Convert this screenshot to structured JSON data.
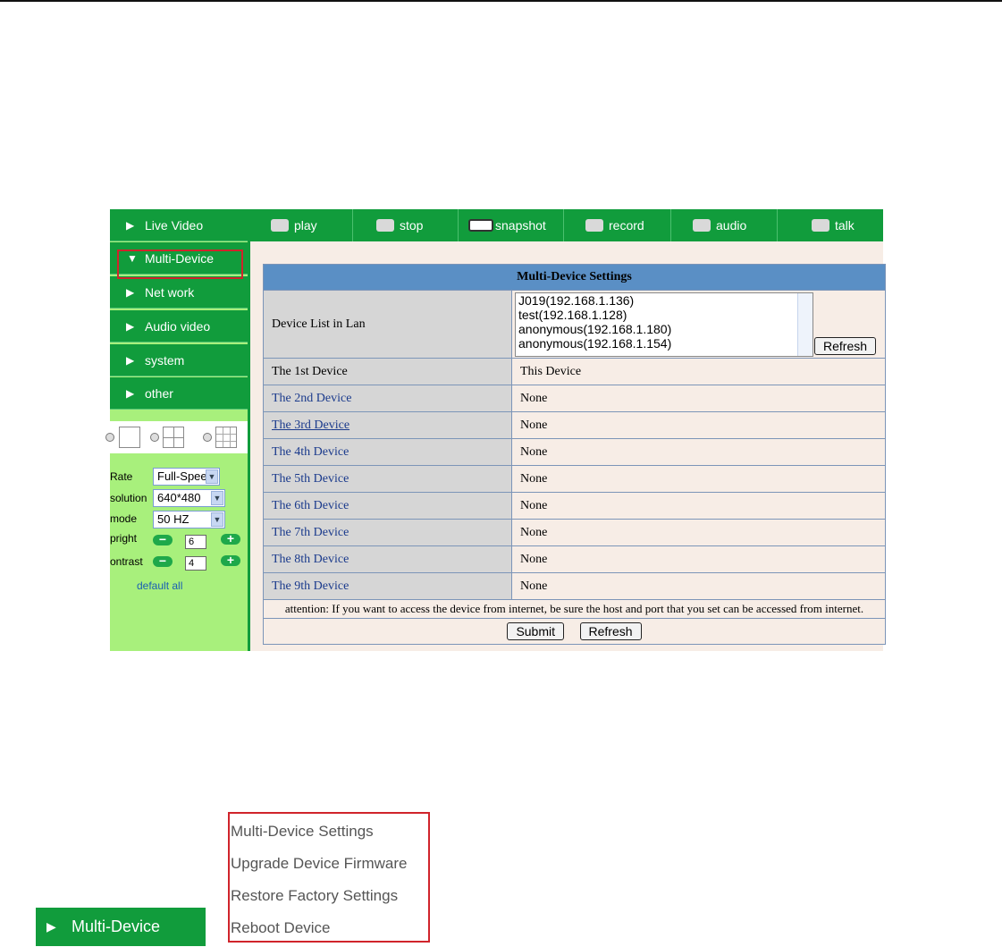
{
  "nav": {
    "items": [
      {
        "label": "Live Video",
        "state": "collapsed"
      },
      {
        "label": "Multi-Device",
        "state": "expanded"
      },
      {
        "label": "Net work",
        "state": "collapsed"
      },
      {
        "label": "Audio video",
        "state": "collapsed"
      },
      {
        "label": "system",
        "state": "collapsed"
      },
      {
        "label": "other",
        "state": "collapsed"
      }
    ],
    "arrow_collapsed": "▶",
    "arrow_expanded": "▼"
  },
  "toolbar": {
    "items": [
      {
        "label": "play",
        "icon": "play-icon"
      },
      {
        "label": "stop",
        "icon": "stop-icon"
      },
      {
        "label": "snapshot",
        "icon": "camera-icon"
      },
      {
        "label": "record",
        "icon": "video-camera-icon"
      },
      {
        "label": "audio",
        "icon": "speaker-icon"
      },
      {
        "label": "talk",
        "icon": "microphone-icon"
      }
    ]
  },
  "controls": {
    "rate_label": "Rate",
    "rate_value": "Full-Speed",
    "resolution_label": "solution",
    "resolution_value": "640*480",
    "mode_label": "mode",
    "mode_value": "50 HZ",
    "bright_label": "pright",
    "bright_value": "6",
    "contrast_label": "ontrast",
    "contrast_value": "4",
    "minus": "−",
    "plus": "+",
    "default_all": "default all"
  },
  "settings": {
    "title": "Multi-Device Settings",
    "device_list_label": "Device List in Lan",
    "device_list": [
      "J019(192.168.1.136)",
      "test(192.168.1.128)",
      "anonymous(192.168.1.180)",
      "anonymous(192.168.1.154)"
    ],
    "list_refresh": "Refresh",
    "devices": [
      {
        "name": "The 1st Device",
        "value": "This Device"
      },
      {
        "name": "The 2nd Device",
        "value": "None"
      },
      {
        "name": "The 3rd Device",
        "value": "None"
      },
      {
        "name": "The 4th Device",
        "value": "None"
      },
      {
        "name": "The 5th Device",
        "value": "None"
      },
      {
        "name": "The 6th Device",
        "value": "None"
      },
      {
        "name": "The 7th Device",
        "value": "None"
      },
      {
        "name": "The 8th Device",
        "value": "None"
      },
      {
        "name": "The 9th Device",
        "value": "None"
      }
    ],
    "attention": "attention: If you want to access the device from internet, be sure the host and port that you set can be accessed from internet.",
    "submit": "Submit",
    "refresh": "Refresh"
  },
  "submenu": {
    "nav_label": "Multi-Device",
    "items": [
      "Multi-Device Settings",
      "Upgrade Device Firmware",
      "Restore Factory Settings",
      "Reboot Device"
    ]
  },
  "colors": {
    "nav_green": "#119c3c",
    "sidebar_light_green": "#a8f07c",
    "highlight_red": "#d0242b",
    "table_header_blue": "#5a8fc5",
    "content_bg": "#f7ede6"
  }
}
